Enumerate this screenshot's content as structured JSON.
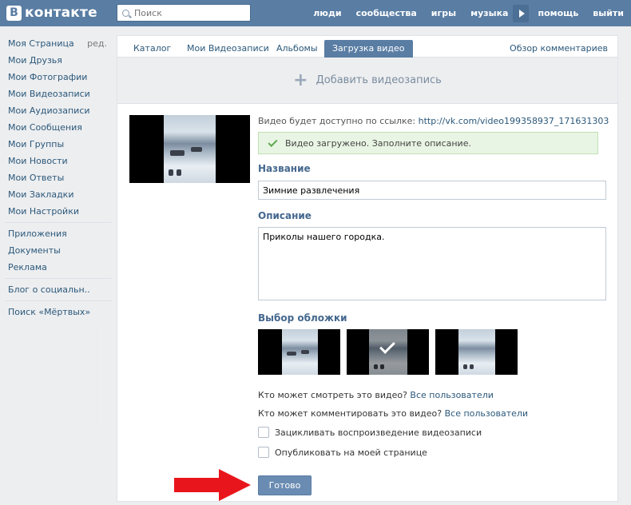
{
  "header": {
    "logo_letter": "В",
    "logo_text": "контакте",
    "search_placeholder": "Поиск",
    "nav": [
      "люди",
      "сообщества",
      "игры",
      "музыка",
      "помощь",
      "выйти"
    ]
  },
  "sidebar": {
    "edit_label": "ред.",
    "group1": [
      "Моя Страница",
      "Мои Друзья",
      "Мои Фотографии",
      "Мои Видеозаписи",
      "Мои Аудиозаписи",
      "Мои Сообщения",
      "Мои Группы",
      "Мои Новости",
      "Мои Ответы",
      "Мои Закладки",
      "Мои Настройки"
    ],
    "group2": [
      "Приложения",
      "Документы",
      "Реклама"
    ],
    "group3": [
      "Блог о социальн.."
    ],
    "group4": [
      "Поиск «Мёртвых»"
    ]
  },
  "tabs": {
    "items": [
      "Каталог",
      "Мои Видеозаписи",
      "Альбомы",
      "Загрузка видео"
    ],
    "active_index": 3,
    "right_link": "Обзор комментариев"
  },
  "add_video": {
    "label": "Добавить видеозапись"
  },
  "upload": {
    "url_prefix": "Видео будет доступно по ссылке:",
    "url": "http://vk.com/video199358937_171631303",
    "notice": "Видео загружено. Заполните описание.",
    "title_label": "Название",
    "title_value": "Зимние развлечения",
    "desc_label": "Описание",
    "desc_value": "Приколы нашего городка.",
    "cover_label": "Выбор обложки",
    "selected_cover_index": 1,
    "view_question": "Кто может смотреть это видео?",
    "view_value": "Все пользователи",
    "comment_question": "Кто может комментировать это видео?",
    "comment_value": "Все пользователи",
    "loop_label": "Зацикливать воспроизведение видеозаписи",
    "publish_label": "Опубликовать на моей странице",
    "done_label": "Готово"
  },
  "colors": {
    "header_bg": "#597da3",
    "link": "#2b587a",
    "arrow": "#e8161c",
    "notice_bg": "#e9f5e4"
  }
}
